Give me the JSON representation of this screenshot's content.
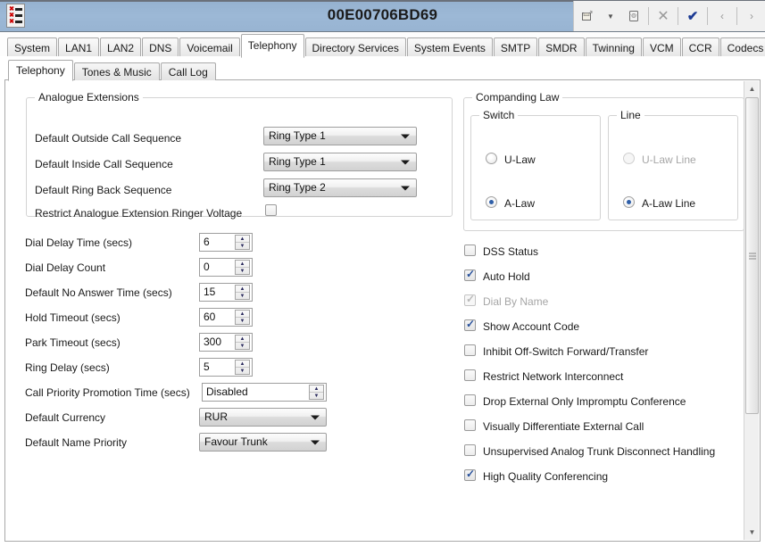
{
  "titlebar": {
    "title": "00E00706BD69",
    "logo_icon": "list-document-icon",
    "buttons": [
      {
        "name": "save-config-icon",
        "glyph": "⎙"
      },
      {
        "name": "dropdown-caret-icon",
        "glyph": "▾"
      },
      {
        "name": "open-file-icon",
        "glyph": "⛃"
      },
      {
        "name": "close-icon",
        "glyph": "✕"
      },
      {
        "name": "validate-check-icon",
        "glyph": "✔"
      },
      {
        "name": "previous-icon",
        "glyph": "‹"
      },
      {
        "name": "next-icon",
        "glyph": "›"
      }
    ]
  },
  "main_tabs": [
    {
      "label": "System",
      "active": false
    },
    {
      "label": "LAN1",
      "active": false
    },
    {
      "label": "LAN2",
      "active": false
    },
    {
      "label": "DNS",
      "active": false
    },
    {
      "label": "Voicemail",
      "active": false
    },
    {
      "label": "Telephony",
      "active": true
    },
    {
      "label": "Directory Services",
      "active": false
    },
    {
      "label": "System Events",
      "active": false
    },
    {
      "label": "SMTP",
      "active": false
    },
    {
      "label": "SMDR",
      "active": false
    },
    {
      "label": "Twinning",
      "active": false
    },
    {
      "label": "VCM",
      "active": false
    },
    {
      "label": "CCR",
      "active": false
    },
    {
      "label": "Codecs",
      "active": false
    }
  ],
  "sub_tabs": [
    {
      "label": "Telephony",
      "active": true
    },
    {
      "label": "Tones & Music",
      "active": false
    },
    {
      "label": "Call Log",
      "active": false
    }
  ],
  "analogue_extensions": {
    "legend": "Analogue Extensions",
    "fields": [
      {
        "label": "Default Outside Call Sequence",
        "value": "Ring Type 1"
      },
      {
        "label": "Default Inside Call Sequence",
        "value": "Ring Type 1"
      },
      {
        "label": "Default Ring Back Sequence",
        "value": "Ring Type 2"
      }
    ],
    "restrict_label": "Restrict Analogue Extension Ringer Voltage",
    "restrict_checked": false
  },
  "left_fields": [
    {
      "label": "Dial Delay Time (secs)",
      "value": "6",
      "type": "spin"
    },
    {
      "label": "Dial Delay Count",
      "value": "0",
      "type": "spin"
    },
    {
      "label": "Default No Answer Time (secs)",
      "value": "15",
      "type": "spin"
    },
    {
      "label": "Hold Timeout (secs)",
      "value": "60",
      "type": "spin"
    },
    {
      "label": "Park Timeout (secs)",
      "value": "300",
      "type": "spin"
    },
    {
      "label": "Ring Delay (secs)",
      "value": "5",
      "type": "spin"
    },
    {
      "label": "Call Priority Promotion Time (secs)",
      "value": "Disabled",
      "type": "spin-wide"
    },
    {
      "label": "Default Currency",
      "value": "RUR",
      "type": "combo"
    },
    {
      "label": "Default Name Priority",
      "value": "Favour Trunk",
      "type": "combo"
    }
  ],
  "companding_law": {
    "legend": "Companding Law",
    "switch": {
      "legend": "Switch",
      "options": [
        {
          "label": "U-Law",
          "selected": false,
          "disabled": false
        },
        {
          "label": "A-Law",
          "selected": true,
          "disabled": false
        }
      ]
    },
    "line": {
      "legend": "Line",
      "options": [
        {
          "label": "U-Law Line",
          "selected": false,
          "disabled": true
        },
        {
          "label": "A-Law Line",
          "selected": true,
          "disabled": false
        }
      ]
    }
  },
  "checkboxes": [
    {
      "label": "DSS Status",
      "checked": false,
      "disabled": false
    },
    {
      "label": "Auto Hold",
      "checked": true,
      "disabled": false
    },
    {
      "label": "Dial By Name",
      "checked": true,
      "disabled": true
    },
    {
      "label": "Show Account Code",
      "checked": true,
      "disabled": false
    },
    {
      "label": "Inhibit Off-Switch Forward/Transfer",
      "checked": false,
      "disabled": false
    },
    {
      "label": "Restrict Network Interconnect",
      "checked": false,
      "disabled": false
    },
    {
      "label": "Drop External Only Impromptu Conference",
      "checked": false,
      "disabled": false
    },
    {
      "label": "Visually Differentiate External Call",
      "checked": false,
      "disabled": false
    },
    {
      "label": "Unsupervised Analog Trunk Disconnect Handling",
      "checked": false,
      "disabled": false
    },
    {
      "label": "High Quality Conferencing",
      "checked": true,
      "disabled": false
    }
  ],
  "colors": {
    "titlebar": "#98b4d2",
    "accent_check": "#27509b",
    "radio_dot": "#2f5fa8",
    "border": "#a9a9a9"
  }
}
